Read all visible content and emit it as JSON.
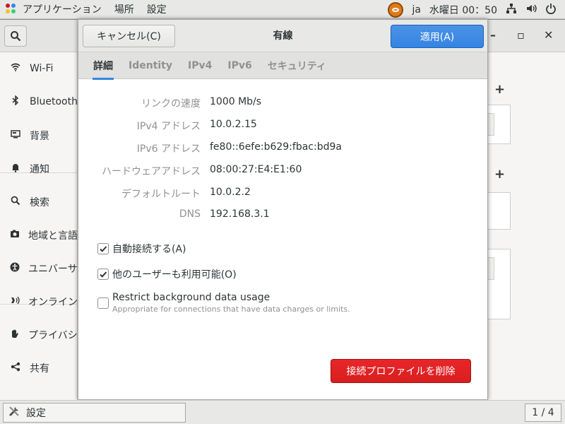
{
  "topbar": {
    "applications": "アプリケーション",
    "places": "場所",
    "settings": "設定",
    "input_method": "ja",
    "clock": "水曜日 00：50"
  },
  "sidebar": {
    "items": [
      {
        "label": "Wi-Fi",
        "icon": "wifi-icon"
      },
      {
        "label": "Bluetooth",
        "icon": "bluetooth-icon"
      },
      {
        "label": "背景",
        "icon": "background-icon"
      },
      {
        "label": "通知",
        "icon": "bell-icon"
      },
      {
        "label": "検索",
        "icon": "search-icon"
      },
      {
        "label": "地域と言語",
        "icon": "region-icon"
      },
      {
        "label": "ユニバーサルアクセス",
        "icon": "accessibility-icon"
      },
      {
        "label": "オンラインアカウント",
        "icon": "online-accounts-icon"
      },
      {
        "label": "プライバシー",
        "icon": "privacy-hand-icon"
      },
      {
        "label": "共有",
        "icon": "share-icon"
      }
    ]
  },
  "dialog": {
    "title": "有線",
    "cancel_label": "キャンセル(C)",
    "apply_label": "適用(A)",
    "tabs": [
      "詳細",
      "Identity",
      "IPv4",
      "IPv6",
      "セキュリティ"
    ],
    "active_tab": 0,
    "details": [
      {
        "label": "リンクの速度",
        "value": "1000 Mb/s"
      },
      {
        "label": "IPv4 アドレス",
        "value": "10.0.2.15"
      },
      {
        "label": "IPv6 アドレス",
        "value": "fe80::6efe:b629:fbac:bd9a"
      },
      {
        "label": "ハードウェアアドレス",
        "value": "08:00:27:E4:E1:60"
      },
      {
        "label": "デフォルトルート",
        "value": "10.0.2.2"
      },
      {
        "label": "DNS",
        "value": "192.168.3.1"
      }
    ],
    "checks": [
      {
        "label": "自動接続する(A)",
        "checked": true
      },
      {
        "label": "他のユーザーも利用可能(O)",
        "checked": true
      },
      {
        "label": "Restrict background data usage",
        "sublabel": "Appropriate for connections that have data charges or limits.",
        "checked": false
      }
    ],
    "delete_label": "接続プロファイルを削除"
  },
  "taskbar": {
    "window_label": "設定",
    "workspace": "1 / 4"
  },
  "colors": {
    "accent": "#3584e4",
    "destructive": "#e01b24"
  }
}
